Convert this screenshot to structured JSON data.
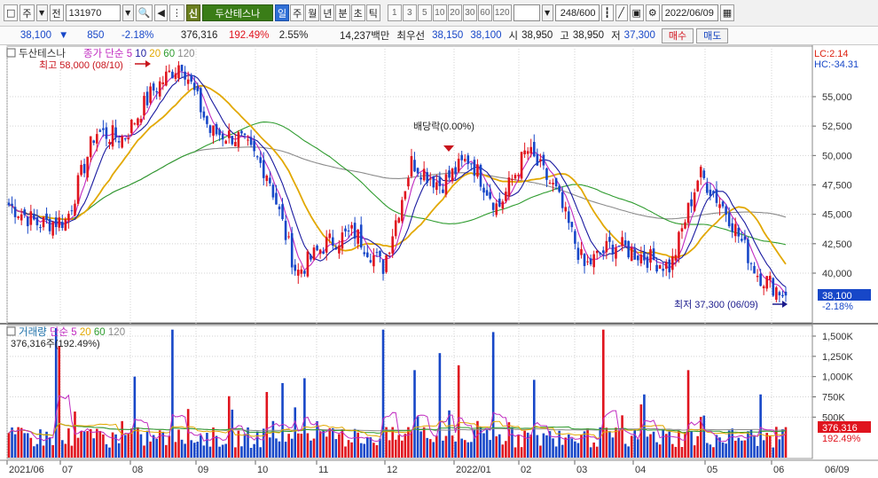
{
  "toolbar": {
    "market": "주",
    "prefix": "전",
    "code": "131970",
    "badge": "신",
    "stock_name": "두산테스나",
    "periods": [
      "일",
      "주",
      "월",
      "년",
      "분",
      "초",
      "틱"
    ],
    "selected_period": "일",
    "minute_presets": [
      "1",
      "3",
      "5",
      "10",
      "20",
      "30",
      "60",
      "120"
    ],
    "count": "248/600",
    "date": "2022/06/09"
  },
  "quote": {
    "price": "38,100",
    "arrow": "▼",
    "change": "850",
    "change_pct": "-2.18%",
    "volume": "376,316",
    "volume_ratio": "192.49%",
    "turnover": "2.55%",
    "amount": "14,237백만",
    "best_ask_label": "최우선",
    "best_ask": "38,150",
    "best_bid": "38,100",
    "open_label": "시",
    "open": "38,950",
    "high_label": "고",
    "high": "38,950",
    "low_label": "저",
    "low": "37,300",
    "buy_label": "매수",
    "sell_label": "매도"
  },
  "colors": {
    "up": "#e0141e",
    "down": "#1747c8",
    "ma5": "#c02ac0",
    "ma10": "#1a1aa0",
    "ma20": "#e2a800",
    "ma60": "#2f9c2f",
    "ma120": "#8a8a8a",
    "grid": "#d3d3d3"
  },
  "price_panel": {
    "legend_name": "두산테스나",
    "legend_ma": [
      "종가 단순",
      "5",
      "10",
      "20",
      "60",
      "120"
    ],
    "lc": "LC:2.14",
    "hc": "HC:-34.31",
    "high_annot": "최고 58,000 (08/10)",
    "low_annot": "최저 37,300 (06/09)",
    "dividend_annot": "배당락(0.00%)",
    "current_price_tag": "38,100",
    "current_pct_tag": "-2.18%"
  },
  "volume_panel": {
    "legend_name": "거래량",
    "legend_ma": [
      "단순",
      "5",
      "20",
      "60",
      "120"
    ],
    "last_label": "376,316주(192.49%)",
    "current_tag": "376,316",
    "current_pct_tag": "192.49%"
  },
  "chart_data": {
    "type": "candlestick",
    "x_labels": [
      "2021/06",
      "07",
      "08",
      "09",
      "10",
      "11",
      "12",
      "2022/01",
      "02",
      "03",
      "04",
      "05",
      "06"
    ],
    "x_right_label": "06/09",
    "y_price_ticks": [
      "55,000",
      "52,500",
      "50,000",
      "47,500",
      "45,000",
      "42,500",
      "40,000"
    ],
    "y_price_range": [
      37000,
      59000
    ],
    "y_volume_ticks": [
      "1,500K",
      "1,250K",
      "1,000K",
      "750K",
      "500K"
    ],
    "y_volume_range": [
      0,
      1600000
    ],
    "price_path": [
      {
        "month": "2021/06",
        "close": 45800
      },
      {
        "month": "2021/06 end",
        "close": 44200
      },
      {
        "month": "07 start",
        "close": 44500
      },
      {
        "month": "07",
        "close": 52000
      },
      {
        "month": "07 end",
        "close": 51500
      },
      {
        "month": "08",
        "close": 55500
      },
      {
        "month": "08 peak",
        "close": 58000
      },
      {
        "month": "08 end",
        "close": 52000
      },
      {
        "month": "09",
        "close": 51500
      },
      {
        "month": "09 end",
        "close": 48500
      },
      {
        "month": "10",
        "close": 40000
      },
      {
        "month": "10 mid",
        "close": 42500
      },
      {
        "month": "11",
        "close": 43500
      },
      {
        "month": "11 end",
        "close": 40500
      },
      {
        "month": "12",
        "close": 49500
      },
      {
        "month": "12 end",
        "close": 47500
      },
      {
        "month": "2022/01",
        "close": 49800
      },
      {
        "month": "2022/01 end",
        "close": 45500
      },
      {
        "month": "02",
        "close": 50500
      },
      {
        "month": "02 end",
        "close": 47000
      },
      {
        "month": "03",
        "close": 40500
      },
      {
        "month": "03 end",
        "close": 42500
      },
      {
        "month": "04",
        "close": 41500
      },
      {
        "month": "04 end",
        "close": 40500
      },
      {
        "month": "05",
        "close": 48500
      },
      {
        "month": "05 mid",
        "close": 45000
      },
      {
        "month": "06",
        "close": 40000
      },
      {
        "month": "06/09",
        "close": 38100
      }
    ]
  }
}
